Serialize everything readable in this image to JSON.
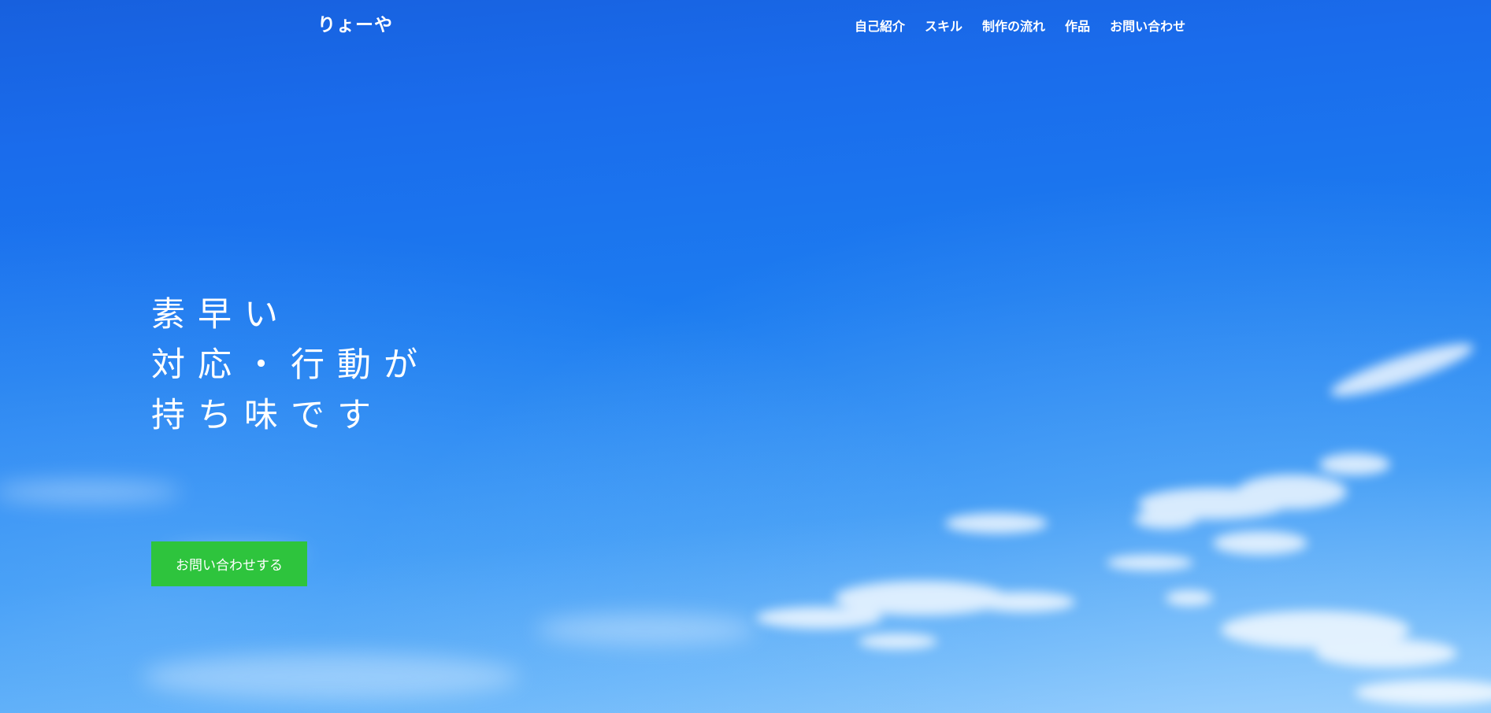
{
  "header": {
    "logo": "りょーや",
    "nav": [
      {
        "label": "自己紹介"
      },
      {
        "label": "スキル"
      },
      {
        "label": "制作の流れ"
      },
      {
        "label": "作品"
      },
      {
        "label": "お問い合わせ"
      }
    ]
  },
  "hero": {
    "catch_lines": [
      "素早い",
      "対応・行動が",
      "持ち味です"
    ],
    "cta_label": "お問い合わせする"
  },
  "colors": {
    "sky_top": "#1760de",
    "sky_bottom": "#82c4fb",
    "cta_background": "#2ec43d",
    "text": "#ffffff"
  }
}
